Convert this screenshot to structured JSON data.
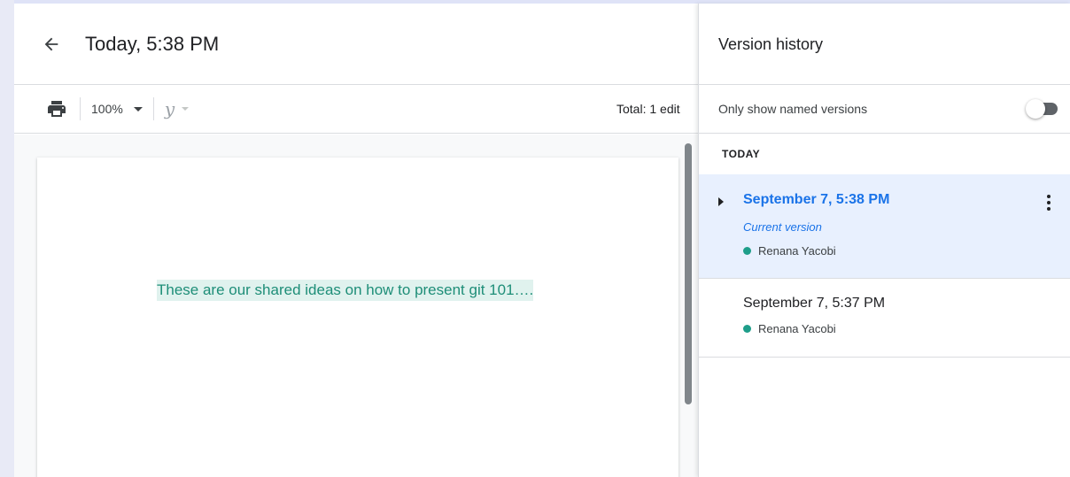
{
  "header": {
    "title": "Today, 5:38 PM"
  },
  "toolbar": {
    "zoom": "100%",
    "style_glyph": "y",
    "total_edits": "Total: 1 edit"
  },
  "document": {
    "text": "These are our shared ideas on how to present git 101…."
  },
  "version_history": {
    "title": "Version history",
    "filter_label": "Only show named versions",
    "filter_enabled": false,
    "section_label": "TODAY",
    "entries": [
      {
        "date": "September 7, 5:38 PM",
        "tag": "Current version",
        "user": "Renana Yacobi",
        "selected": true
      },
      {
        "date": "September 7, 5:37 PM",
        "user": "Renana Yacobi",
        "selected": false
      }
    ]
  },
  "icons": {
    "back": "arrow-back-icon",
    "print": "print-icon",
    "more": "more-vert-icon",
    "expand": "triangle-right-icon"
  },
  "colors": {
    "accent": "#1a73e8",
    "highlight": "#e0f2ee",
    "user_dot": "#1e9e8a",
    "selected_bg": "#e8f0fe"
  }
}
